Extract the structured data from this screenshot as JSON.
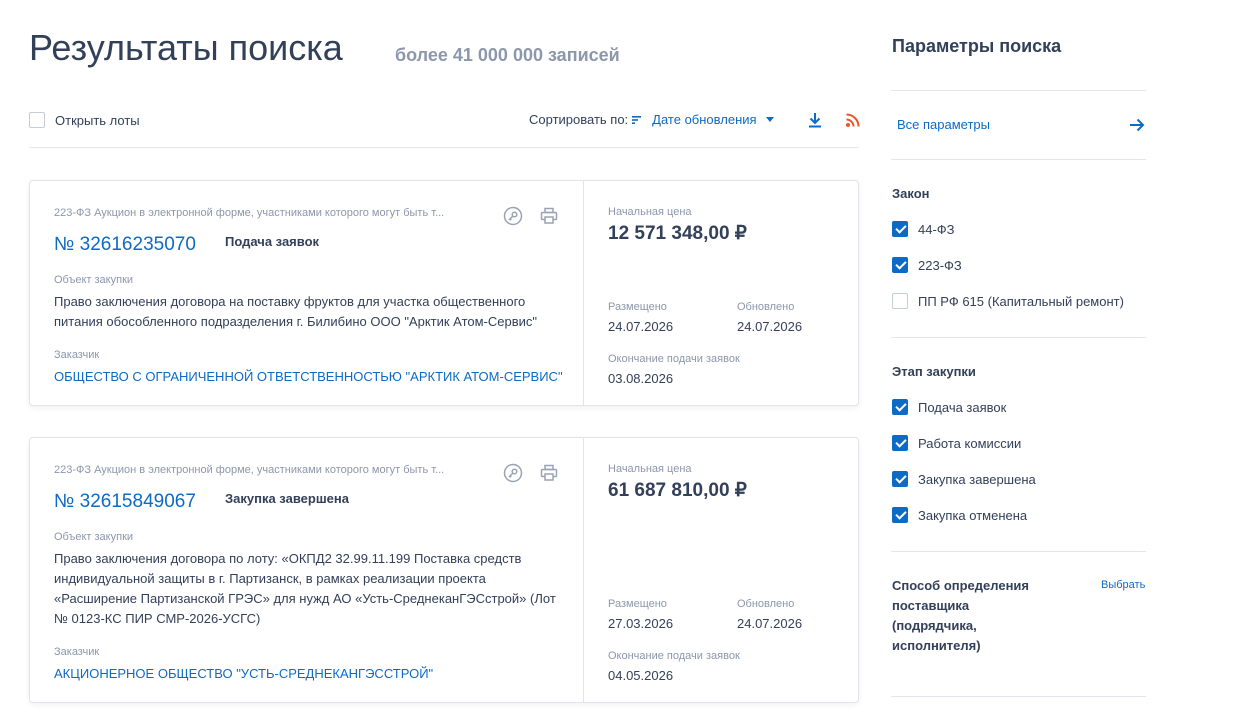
{
  "header": {
    "title": "Результаты поиска",
    "count": "более 41 000 000 записей"
  },
  "toolbar": {
    "open_lots": "Открыть лоты",
    "sort_label": "Сортировать по:",
    "sort_value": "Дате обновления"
  },
  "results": [
    {
      "procedure_type": "223-ФЗ Аукцион в электронной форме, участниками которого могут быть т...",
      "number": "№ 32616235070",
      "stage": "Подача заявок",
      "object_label": "Объект закупки",
      "object": "Право заключения договора на поставку фруктов для участка общественного питания обособленного подразделения г. Билибино ООО \"Арктик Атом-Сервис\"",
      "customer_label": "Заказчик",
      "customer": "ОБЩЕСТВО С ОГРАНИЧЕННОЙ ОТВЕТСТВЕННОСТЬЮ \"АРКТИК АТОМ-СЕРВИС\"",
      "price_label": "Начальная цена",
      "price": "12 571 348,00 ₽",
      "posted_label": "Размещено",
      "posted": "24.07.2026",
      "updated_label": "Обновлено",
      "updated": "24.07.2026",
      "deadline_label": "Окончание подачи заявок",
      "deadline": "03.08.2026"
    },
    {
      "procedure_type": "223-ФЗ Аукцион в электронной форме, участниками которого могут быть т...",
      "number": "№ 32615849067",
      "stage": "Закупка завершена",
      "object_label": "Объект закупки",
      "object": "Право заключения договора по лоту: «ОКПД2 32.99.11.199 Поставка средств индивидуальной защиты в г. Партизанск, в рамках реализации проекта «Расширение Партизанской ГРЭС» для нужд АО «Усть-СреднеканГЭСстрой» (Лот № 0123-КС ПИР СМР-2026-УСГС)",
      "customer_label": "Заказчик",
      "customer": "АКЦИОНЕРНОЕ ОБЩЕСТВО \"УСТЬ-СРЕДНЕКАНГЭССТРОЙ\"",
      "price_label": "Начальная цена",
      "price": "61 687 810,00 ₽",
      "posted_label": "Размещено",
      "posted": "27.03.2026",
      "updated_label": "Обновлено",
      "updated": "24.07.2026",
      "deadline_label": "Окончание подачи заявок",
      "deadline": "04.05.2026"
    }
  ],
  "sidebar": {
    "title": "Параметры поиска",
    "all_params": "Все параметры",
    "law": {
      "title": "Закон",
      "items": [
        {
          "label": "44-ФЗ",
          "checked": true
        },
        {
          "label": "223-ФЗ",
          "checked": true
        },
        {
          "label": "ПП РФ 615 (Капитальный ремонт)",
          "checked": false
        }
      ]
    },
    "stage": {
      "title": "Этап закупки",
      "items": [
        {
          "label": "Подача заявок",
          "checked": true
        },
        {
          "label": "Работа комиссии",
          "checked": true
        },
        {
          "label": "Закупка завершена",
          "checked": true
        },
        {
          "label": "Закупка отменена",
          "checked": true
        }
      ]
    },
    "method": {
      "title": "Способ определения поставщика (подрядчика, исполнителя)",
      "choose": "Выбрать"
    }
  },
  "colors": {
    "accent": "#0d6ac5",
    "text": "#334059",
    "muted": "#8c97ab",
    "rss": "#e8562a"
  },
  "icons": [
    "sort-icon",
    "download-icon",
    "rss-icon",
    "key-icon",
    "print-icon",
    "arrow-right-icon",
    "checkbox-icon"
  ]
}
